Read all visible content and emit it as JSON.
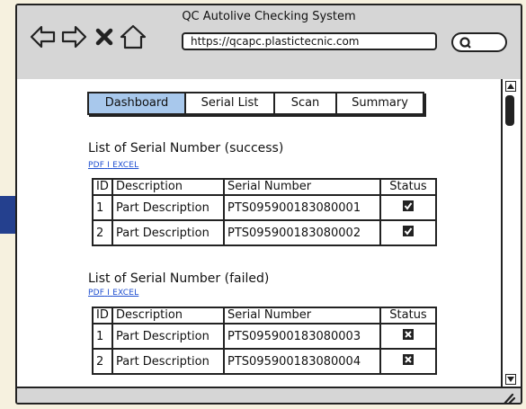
{
  "window": {
    "title": "QC Autolive Checking System"
  },
  "browser": {
    "url": "https://qcapc.plastictecnic.com"
  },
  "tabs": [
    "Dashboard",
    "Serial List",
    "Scan",
    "Summary"
  ],
  "active_tab": "Dashboard",
  "export_links": {
    "pdf": "PDF",
    "sep": "I",
    "excel": "EXCEL"
  },
  "columns": [
    "ID",
    "Description",
    "Serial Number",
    "Status"
  ],
  "success": {
    "heading": "List of Serial Number (success)",
    "rows": [
      {
        "id": "1",
        "description": "Part Description",
        "serial": "PTS095900183080001",
        "status": "checked"
      },
      {
        "id": "2",
        "description": "Part Description",
        "serial": "PTS095900183080002",
        "status": "checked"
      }
    ]
  },
  "failed": {
    "heading": "List of Serial Number (failed)",
    "rows": [
      {
        "id": "1",
        "description": "Part Description",
        "serial": "PTS095900183080003",
        "status": "crossed"
      },
      {
        "id": "2",
        "description": "Part Description",
        "serial": "PTS095900183080004",
        "status": "crossed"
      }
    ]
  },
  "colors": {
    "accent_tab": "#a8c8ec",
    "arrow": "#24408e",
    "link": "#1f4fd0"
  }
}
